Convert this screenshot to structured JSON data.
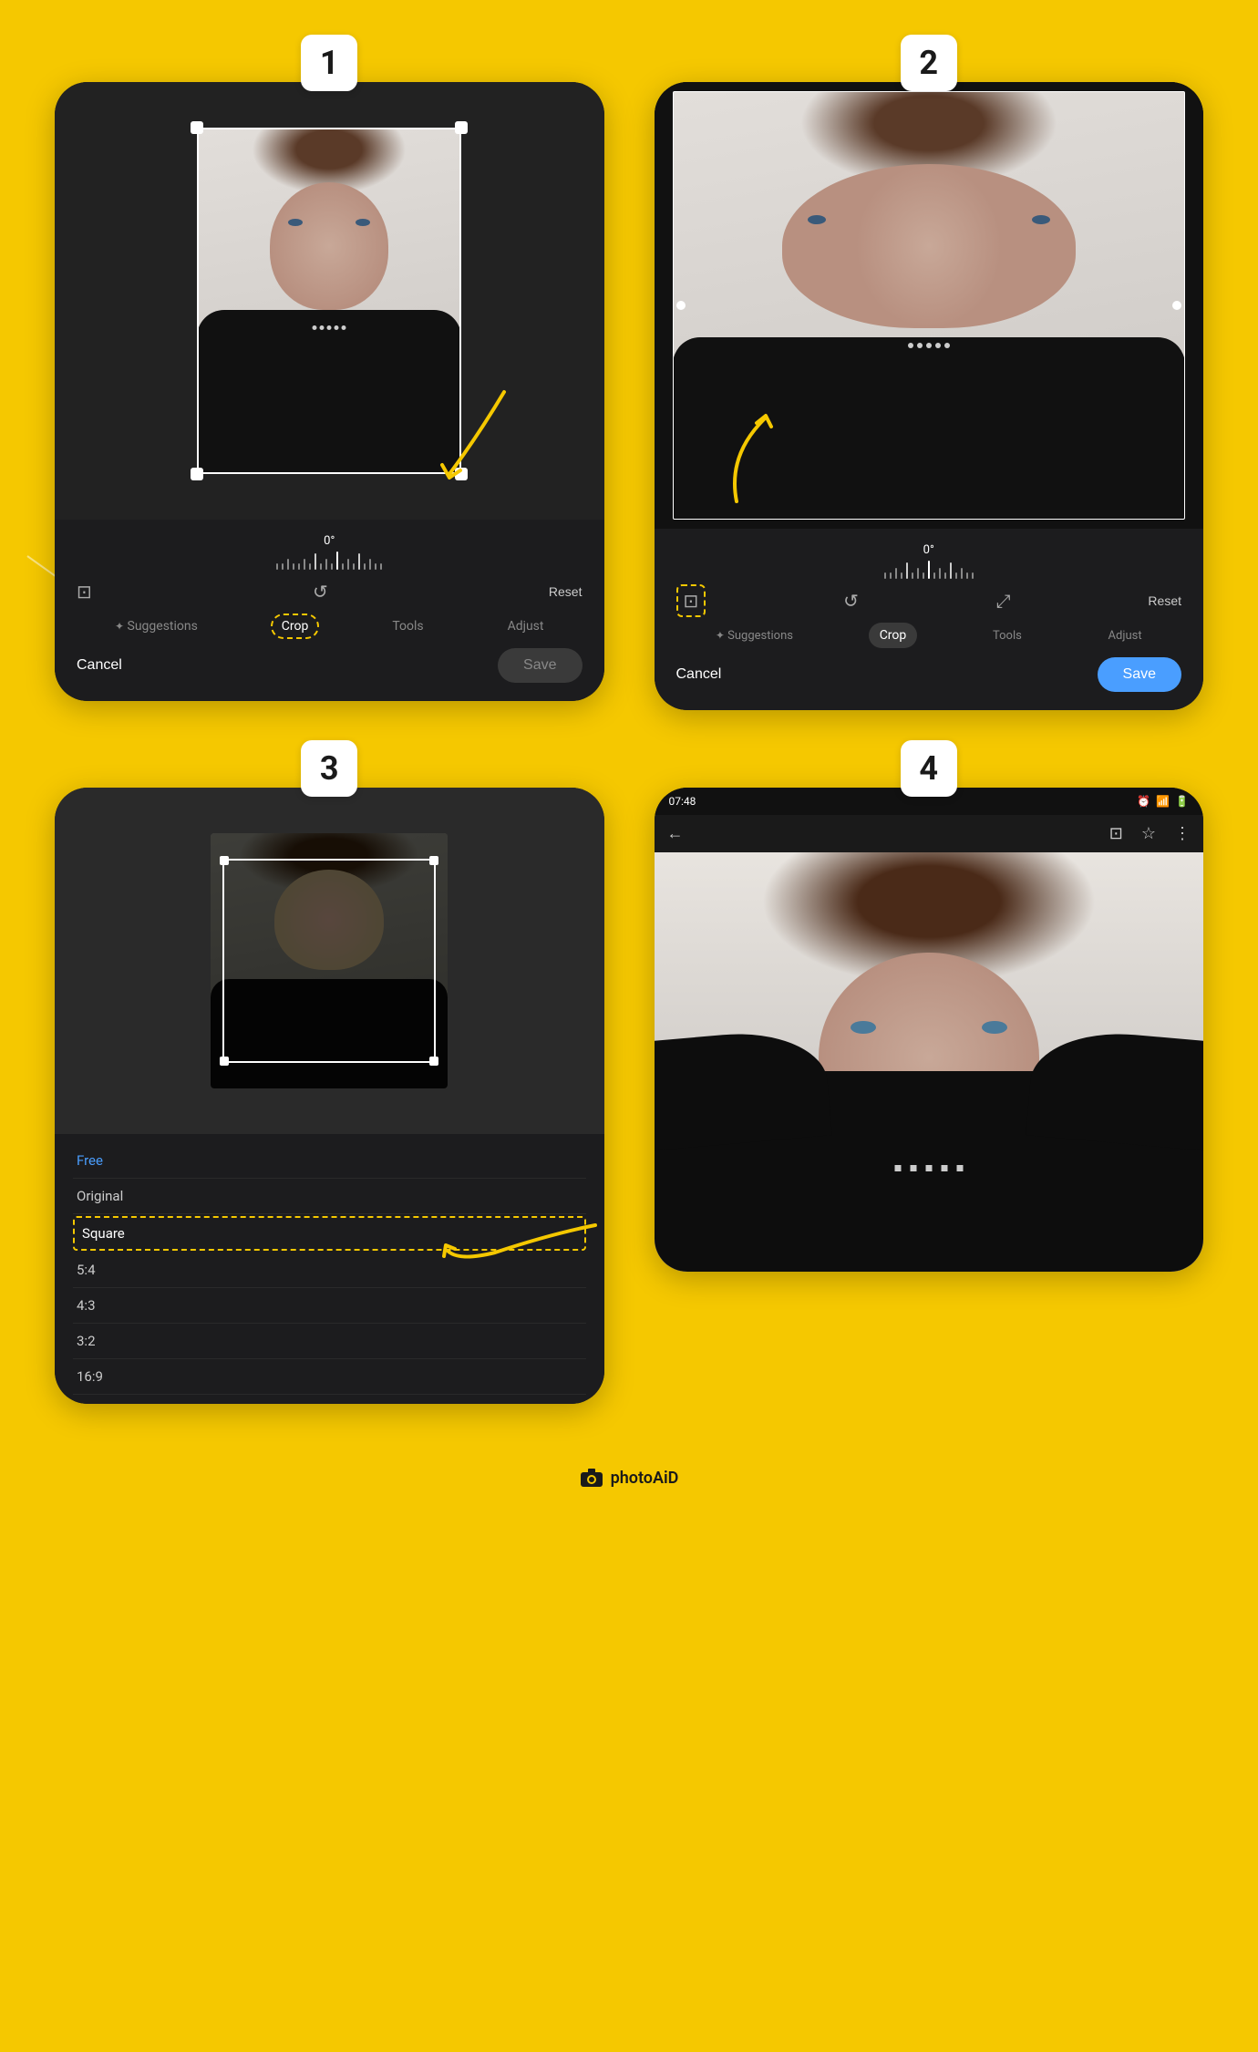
{
  "page": {
    "background_color": "#F5C800",
    "brand": "photoAiD"
  },
  "steps": [
    {
      "number": "1",
      "label": "Step 1",
      "controls": {
        "degree": "0°",
        "toolbar_icons": [
          "aspect-ratio-icon",
          "rotate-icon"
        ],
        "reset": "Reset",
        "tabs": [
          "Suggestions",
          "Crop",
          "Tools",
          "Adjust"
        ],
        "active_tab": "Crop",
        "cancel": "Cancel",
        "save": "Save"
      }
    },
    {
      "number": "2",
      "label": "Step 2",
      "controls": {
        "degree": "0°",
        "toolbar_icons": [
          "aspect-ratio-icon",
          "rotate-icon",
          "expand-icon"
        ],
        "reset": "Reset",
        "tabs": [
          "Suggestions",
          "Crop",
          "Tools",
          "Adjust"
        ],
        "active_tab": "Crop",
        "cancel": "Cancel",
        "save": "Save"
      }
    },
    {
      "number": "3",
      "label": "Step 3",
      "crop_options": [
        "Free",
        "Original",
        "Square",
        "5:4",
        "4:3",
        "3:2",
        "16:9"
      ],
      "active_option": "Free",
      "highlighted_option": "Square"
    },
    {
      "number": "4",
      "label": "Step 4",
      "status_bar": {
        "time": "07:48",
        "icons": [
          "alarm-icon",
          "wifi-icon",
          "signal-icon",
          "battery-icon"
        ]
      },
      "browser_icons": [
        "back-icon",
        "cast-icon",
        "star-icon",
        "more-icon"
      ]
    }
  ],
  "arrows": [
    {
      "id": "arrow1",
      "description": "pointing to Crop tab in step 1"
    },
    {
      "id": "arrow2",
      "description": "pointing to aspect-ratio icon in step 2"
    },
    {
      "id": "arrow3",
      "description": "pointing to Square option in step 3"
    }
  ],
  "footer": {
    "logo_text": "photoAiD",
    "logo_icon": "camera-icon"
  }
}
